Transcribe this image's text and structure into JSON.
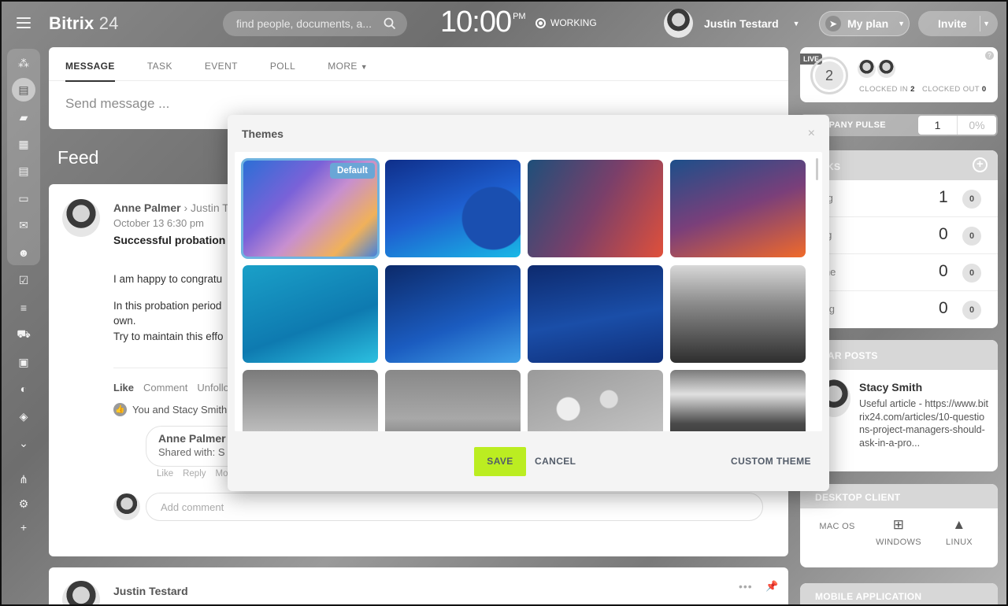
{
  "header": {
    "logo_main": "Bitrix",
    "logo_suffix": " 24",
    "search_placeholder": "find people, documents, a...",
    "time": "10:00",
    "ampm": "PM",
    "status": "WORKING",
    "user_name": "Justin Testard",
    "plan_label": "My plan",
    "invite_label": "Invite"
  },
  "composer": {
    "tabs": [
      "MESSAGE",
      "TASK",
      "EVENT",
      "POLL",
      "MORE"
    ],
    "placeholder": "Send message ..."
  },
  "feed": {
    "title": "Feed",
    "post": {
      "author": "Anne Palmer",
      "recipient": "Justin T",
      "date": "October 13 6:30 pm",
      "title": "Successful probation",
      "body1": "I am happy to congratu",
      "body2a": "In this probation period",
      "body2b": "own.",
      "body3": "Try to maintain this effo",
      "actions": [
        "Like",
        "Comment",
        "Unfollo"
      ],
      "likes": "You and Stacy Smith",
      "comment_author": "Anne Palmer",
      "comment_text": "Shared with: S",
      "comment_actions": [
        "Like",
        "Reply",
        "Mo"
      ],
      "add_comment": "Add comment"
    },
    "post2_author": "Justin Testard"
  },
  "right": {
    "live": {
      "tag": "LIVE",
      "count": "2",
      "clocked_in_label": "CLOCKED IN",
      "clocked_in": "2",
      "clocked_out_label": "CLOCKED OUT",
      "clocked_out": "0",
      "help": "?"
    },
    "pulse": {
      "label": "COMPANY PULSE",
      "value": "1",
      "percent": "0%"
    },
    "tasks": {
      "title": "TASKS",
      "rows": [
        {
          "label": "going",
          "count": "1",
          "badge": "0"
        },
        {
          "label": "isting",
          "count": "0",
          "badge": "0"
        },
        {
          "label": "by me",
          "count": "0",
          "badge": "0"
        },
        {
          "label": "owing",
          "count": "0",
          "badge": "0"
        }
      ]
    },
    "popular": {
      "title": "PULAR POSTS",
      "author": "Stacy Smith",
      "text": "Useful article - https://www.bitrix24.com/articles/10-questions-project-managers-should-ask-in-a-pro..."
    },
    "desktop": {
      "title": "DESKTOP CLIENT",
      "mac": "MAC OS",
      "win": "WINDOWS",
      "linux": "LINUX"
    },
    "mobile_title": "MOBILE APPLICATION"
  },
  "modal": {
    "title": "Themes",
    "default_badge": "Default",
    "save": "SAVE",
    "cancel": "CANCEL",
    "custom": "CUSTOM THEME",
    "themes": [
      {
        "name": "default",
        "selected": true,
        "bg": "linear-gradient(135deg,#2a6fd6 0%,#7a62d8 35%,#c78fd0 55%,#f0b15a 80%,#3f7fe0 100%)"
      },
      {
        "name": "blue-curves",
        "selected": false,
        "bg": "radial-gradient(circle at 80% 60%,#1a4fb0 0 25%,transparent 26%),linear-gradient(160deg,#0f2f8a 0%,#1e5fd0 50%,#19b8e6 100%)"
      },
      {
        "name": "teal-red",
        "selected": false,
        "bg": "linear-gradient(120deg,#1e4f7a 0%,#7a3f6a 50%,#e0503a 100%)"
      },
      {
        "name": "navy-orange",
        "selected": false,
        "bg": "linear-gradient(160deg,#1d4f8a 0%,#7a3f7a 50%,#f06a2a 100%)"
      },
      {
        "name": "turquoise",
        "selected": false,
        "bg": "linear-gradient(160deg,#1aa0c8 0%,#0e7ab0 60%,#2cc0e0 100%)"
      },
      {
        "name": "deep-blue",
        "selected": false,
        "bg": "linear-gradient(160deg,#0c2a6a 0%,#1b5cc0 60%,#3fa0e8 100%)"
      },
      {
        "name": "dark-blue-wave",
        "selected": false,
        "bg": "linear-gradient(170deg,#0d2a6e 0%,#1a4ea8 55%,#0f2f7a 100%)"
      },
      {
        "name": "lonely-tree",
        "selected": false,
        "bg": "linear-gradient(180deg,#d8d8d8 0%,#8a8a8a 40%,#2e2e2e 100%)"
      },
      {
        "name": "clouds",
        "selected": false,
        "bg": "linear-gradient(180deg,#7a7a7a 0%,#b9b9b9 60%,#f0f0f0 100%)"
      },
      {
        "name": "tulips",
        "selected": false,
        "bg": "linear-gradient(180deg,#888 0%,#a8a8a8 50%,#555 100%)"
      },
      {
        "name": "bokeh",
        "selected": false,
        "bg": "radial-gradient(circle at 30% 40%,#eee 0 10%,transparent 11%),radial-gradient(circle at 60% 30%,#ddd 0 8%,transparent 9%),linear-gradient(160deg,#9a9a9a 0%,#cfcfcf 100%)"
      },
      {
        "name": "sea-sunset",
        "selected": false,
        "bg": "linear-gradient(180deg,#7a7a7a 0%,#e0e0e0 25%,#4a4a4a 55%,#1c1c1c 100%)"
      }
    ]
  }
}
